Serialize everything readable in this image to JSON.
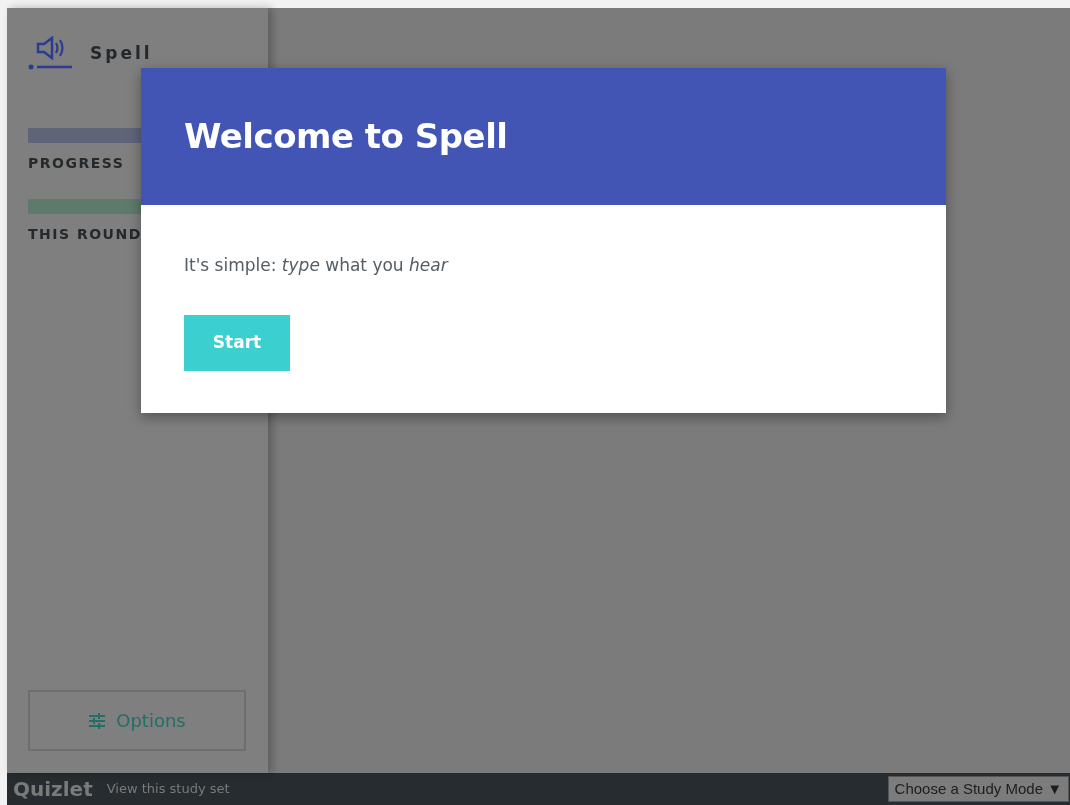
{
  "sidebar": {
    "mode_title": "Spell",
    "meters": [
      {
        "label": "PROGRESS",
        "color": "#5f6479"
      },
      {
        "label": "THIS ROUND",
        "color": "#5e7a6b"
      }
    ],
    "options_button": "Options"
  },
  "modal": {
    "title": "Welcome to Spell",
    "text": "It's simple: *type* what you *hear*",
    "button": "Start"
  },
  "footer": {
    "logo": "Quizlet",
    "link": "View this study set",
    "select": "Choose a Study Mode ▼"
  }
}
